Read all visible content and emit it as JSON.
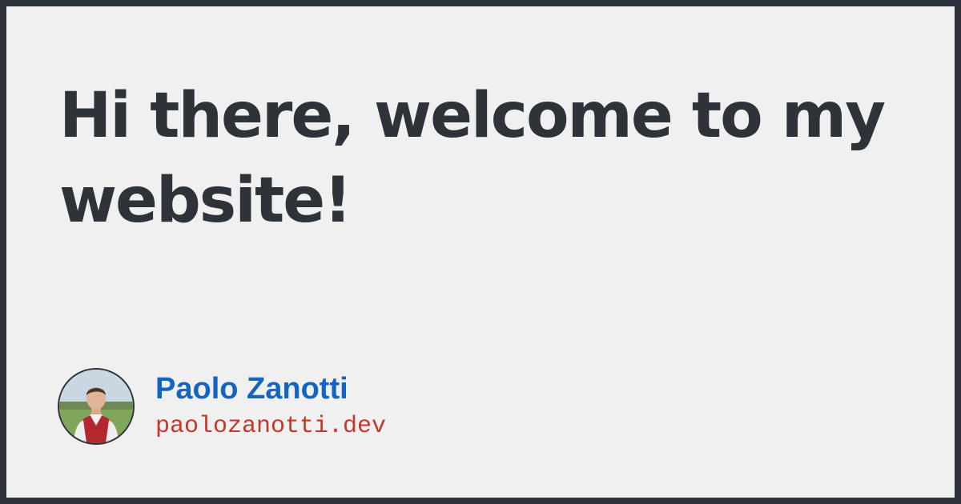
{
  "headline": "Hi there, welcome to my website!",
  "author": {
    "name": "Paolo Zanotti",
    "site": "paolozanotti.dev",
    "avatar_icon": "avatar-photo"
  },
  "colors": {
    "frame": "#2d3339",
    "background": "#f0f0f0",
    "headline": "#2d3339",
    "name": "#1565c0",
    "site": "#c0392b"
  }
}
